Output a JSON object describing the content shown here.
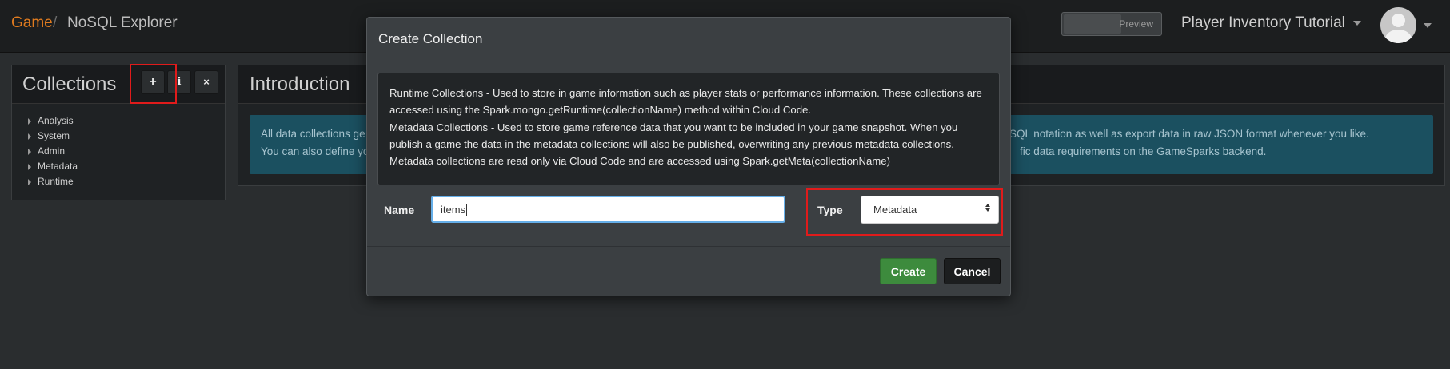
{
  "breadcrumb": {
    "game": "Game",
    "separator": "/",
    "page": "NoSQL Explorer"
  },
  "header": {
    "preview_label": "Preview",
    "project_name": "Player Inventory Tutorial"
  },
  "collections": {
    "title": "Collections",
    "buttons": {
      "add": "+",
      "info": "i",
      "close": "×"
    },
    "items": [
      "Analysis",
      "System",
      "Admin",
      "Metadata",
      "Runtime"
    ]
  },
  "intro": {
    "title": "Introduction",
    "line1_start": "All data collections ge",
    "line1_end": "SQL notation as well as export data in raw JSON format whenever you like.",
    "line2_start": "You can also define yo",
    "line2_end": "fic data requirements on the GameSparks backend."
  },
  "modal": {
    "title": "Create Collection",
    "info_runtime": "Runtime Collections - Used to store in game information such as player stats or performance information. These collections are accessed using the Spark.mongo.getRuntime(collectionName) method within Cloud Code.",
    "info_metadata": "Metadata Collections - Used to store game reference data that you want to be included in your game snapshot. When you publish a game the data in the metadata collections will also be published, overwriting any previous metadata collections. Metadata collections are read only via Cloud Code and are accessed using Spark.getMeta(collectionName)",
    "name_label": "Name",
    "name_value": "items",
    "type_label": "Type",
    "type_value": "Metadata",
    "create_label": "Create",
    "cancel_label": "Cancel"
  },
  "colors": {
    "accent_orange": "#e07b1f",
    "create_green": "#3d8b3d",
    "highlight_red": "#e01b1b",
    "info_teal": "#1b5060"
  }
}
